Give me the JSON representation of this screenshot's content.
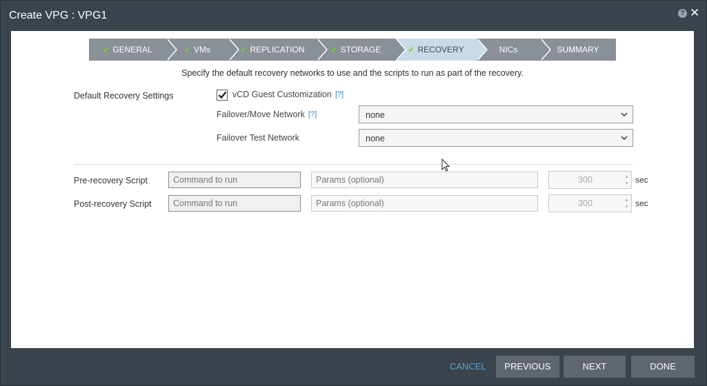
{
  "window": {
    "title": "Create VPG : VPG1"
  },
  "wizard": {
    "steps": [
      {
        "label": "GENERAL",
        "completed": true,
        "active": false
      },
      {
        "label": "VMs",
        "completed": true,
        "active": false
      },
      {
        "label": "REPLICATION",
        "completed": true,
        "active": false
      },
      {
        "label": "STORAGE",
        "completed": true,
        "active": false
      },
      {
        "label": "RECOVERY",
        "completed": true,
        "active": true
      },
      {
        "label": "NICs",
        "completed": false,
        "active": false
      },
      {
        "label": "SUMMARY",
        "completed": false,
        "active": false
      }
    ]
  },
  "main": {
    "instruction": "Specify the default recovery networks to use and the scripts to run as part of the recovery.",
    "section_label": "Default Recovery Settings",
    "vcd_guest_customization": {
      "label": "vCD Guest Customization",
      "checked": true,
      "help": "[?]"
    },
    "failover_move_network": {
      "label": "Failover/Move Network",
      "help": "[?]",
      "value": "none"
    },
    "failover_test_network": {
      "label": "Failover Test Network",
      "value": "none"
    },
    "pre_recovery": {
      "label": "Pre-recovery Script",
      "command_placeholder": "Command to run",
      "params_placeholder": "Params (optional)",
      "timeout": "300",
      "unit": "sec"
    },
    "post_recovery": {
      "label": "Post-recovery Script",
      "command_placeholder": "Command to run",
      "params_placeholder": "Params (optional)",
      "timeout": "300",
      "unit": "sec"
    }
  },
  "footer": {
    "cancel": "CANCEL",
    "previous": "PREVIOUS",
    "next": "NEXT",
    "done": "DONE"
  },
  "colors": {
    "frame": "#3b434c",
    "step_inactive": "#8a9097",
    "step_active": "#c9dbe6",
    "check": "#7ad03a",
    "link": "#5ba3d0",
    "button": "#5f666e"
  }
}
